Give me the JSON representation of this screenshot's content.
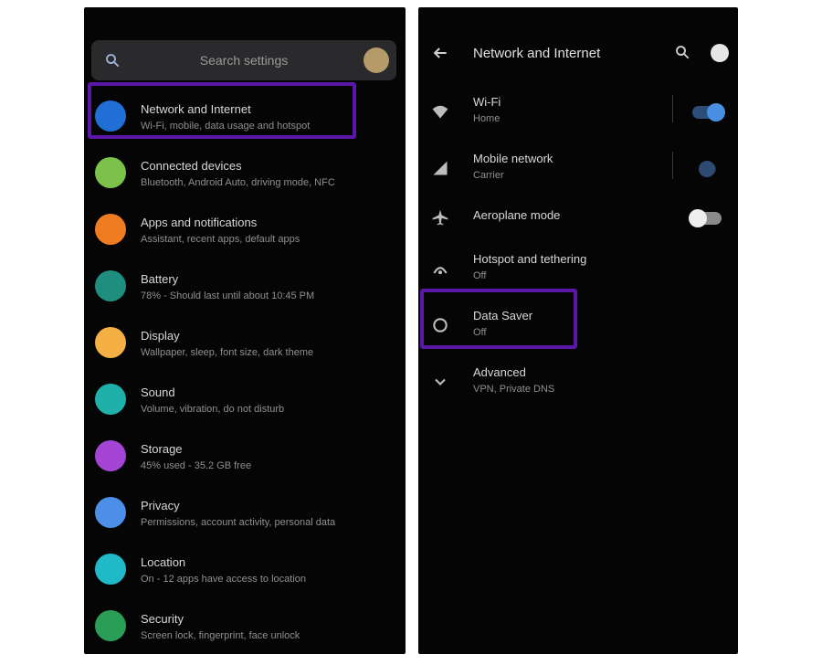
{
  "left_screen": {
    "search": {
      "placeholder": "Search settings",
      "avatar_icon": "account-avatar-icon"
    },
    "items": [
      {
        "title": "Network and Internet",
        "subtitle": "Wi-Fi, mobile, data usage and hotspot",
        "icon": "wifi-icon",
        "color": "#1f6fd6"
      },
      {
        "title": "Connected devices",
        "subtitle": "Bluetooth, Android Auto, driving mode, NFC",
        "icon": "devices-icon",
        "color": "#7cc24a"
      },
      {
        "title": "Apps and notifications",
        "subtitle": "Assistant, recent apps, default apps",
        "icon": "apps-icon",
        "color": "#f07c22"
      },
      {
        "title": "Battery",
        "subtitle": "78% - Should last until about 10:45 PM",
        "icon": "battery-icon",
        "color": "#1e8f7e"
      },
      {
        "title": "Display",
        "subtitle": "Wallpaper, sleep, font size, dark theme",
        "icon": "display-icon",
        "color": "#f4b042"
      },
      {
        "title": "Sound",
        "subtitle": "Volume, vibration, do not disturb",
        "icon": "sound-icon",
        "color": "#1fb0a9"
      },
      {
        "title": "Storage",
        "subtitle": "45% used - 35.2 GB free",
        "icon": "storage-icon",
        "color": "#a445d6"
      },
      {
        "title": "Privacy",
        "subtitle": "Permissions, account activity, personal data",
        "icon": "privacy-icon",
        "color": "#4d8ee8"
      },
      {
        "title": "Location",
        "subtitle": "On - 12 apps have access to location",
        "icon": "location-icon",
        "color": "#20b9c8"
      },
      {
        "title": "Security",
        "subtitle": "Screen lock, fingerprint, face unlock",
        "icon": "security-icon",
        "color": "#2a9d57"
      }
    ]
  },
  "right_screen": {
    "title": "Network and Internet",
    "header_icons": [
      "back-arrow-icon",
      "search-icon",
      "help-icon"
    ],
    "items": [
      {
        "title": "Wi-Fi",
        "subtitle": "Home",
        "icon": "wifi-icon",
        "control": "toggle-on"
      },
      {
        "title": "Mobile network",
        "subtitle": "Carrier",
        "icon": "signal-icon",
        "control": "toggle-off"
      },
      {
        "title": "Aeroplane mode",
        "subtitle": "",
        "icon": "airplane-icon",
        "control": "switch-off"
      },
      {
        "title": "Hotspot and tethering",
        "subtitle": "Off",
        "icon": "hotspot-icon",
        "control": "none"
      },
      {
        "title": "Data Saver",
        "subtitle": "Off",
        "icon": "data-saver-icon",
        "control": "none"
      },
      {
        "title": "Advanced",
        "subtitle": "VPN, Private DNS",
        "icon": "chevron-down-icon",
        "control": "none"
      }
    ]
  },
  "colors": {
    "background": "#050505",
    "highlight": "#5a17a8",
    "toggle_on": "#4a90e2"
  }
}
